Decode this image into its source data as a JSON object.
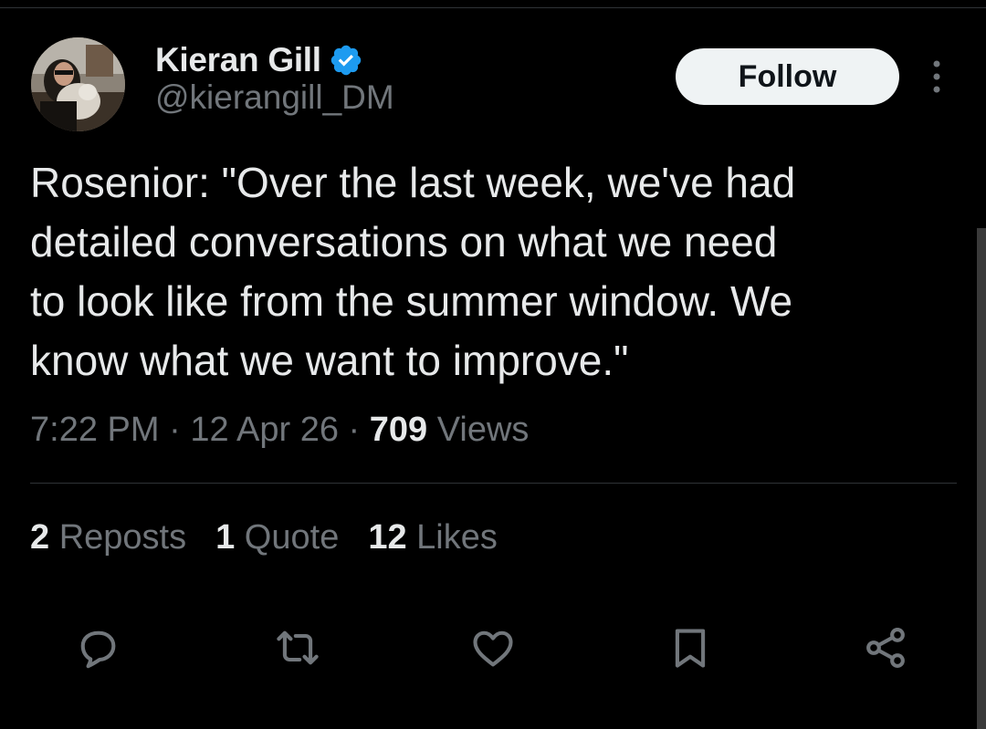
{
  "author": {
    "display_name": "Kieran Gill",
    "handle": "@kierangill_DM",
    "verified": true
  },
  "follow_label": "Follow",
  "tweet": {
    "text": "Rosenior: \"Over the last week, we've had\ndetailed conversations on what we need\nto look like from the summer window. We\nknow what we want to improve.\""
  },
  "meta": {
    "time": "7:22 PM",
    "sep1": " · ",
    "date": "12 Apr 26",
    "sep2": " · ",
    "views_count": "709",
    "views_label": " Views"
  },
  "stats": {
    "reposts_count": "2",
    "reposts_label": " Reposts",
    "quotes_count": "1",
    "quotes_label": " Quote",
    "likes_count": "12",
    "likes_label": " Likes"
  },
  "icons": {
    "verified": "verified-badge-icon",
    "more": "more-vertical-icon",
    "reply": "reply-icon",
    "repost": "repost-icon",
    "like": "heart-icon",
    "bookmark": "bookmark-icon",
    "share": "share-icon"
  },
  "colors": {
    "background": "#000000",
    "primary_text": "#e7e9ea",
    "secondary_text": "#71767b",
    "verified_blue": "#1d9bf0",
    "follow_bg": "#eff3f4"
  }
}
